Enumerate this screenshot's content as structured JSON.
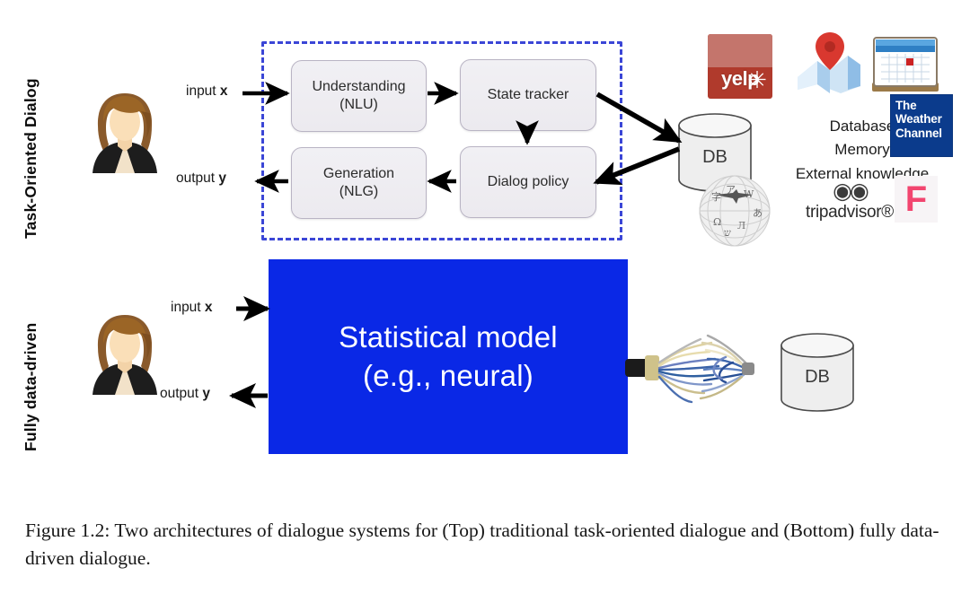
{
  "figure": {
    "caption": "Figure 1.2: Two architectures of dialogue systems for (Top) traditional task-oriented dialogue and (Bottom) fully data-driven dialogue."
  },
  "colors": {
    "dashed_border": "#3b46d6",
    "statistical_model_box": "#0a28e6",
    "module_box_fill": "#eceaef",
    "yelp_red": "#b03a2c",
    "weather_blue": "#0b3b8c",
    "foursquare_pink": "#f2456f"
  },
  "top_row": {
    "row_label": "Task-Oriented Dialog",
    "user_icon": "person-avatar-icon",
    "input_label_prefix": "input ",
    "input_label_var": "x",
    "output_label_prefix": "output ",
    "output_label_var": "y",
    "modules": [
      {
        "id": "nlu",
        "line1": "Understanding",
        "line2": "(NLU)"
      },
      {
        "id": "state-tracker",
        "line1": "State tracker",
        "line2": ""
      },
      {
        "id": "dialog-policy",
        "line1": "Dialog policy",
        "line2": ""
      },
      {
        "id": "nlg",
        "line1": "Generation",
        "line2": "(NLG)"
      }
    ],
    "db": {
      "label": "DB"
    },
    "knowledge_sources": {
      "line1": "Database",
      "line2": "Memory",
      "line3": "External knowledge"
    },
    "logos": [
      {
        "id": "yelp",
        "name": "yelp-logo",
        "text": "yelp",
        "mark": "✳"
      },
      {
        "id": "maps",
        "name": "google-maps-logo",
        "text": ""
      },
      {
        "id": "calendar",
        "name": "calendar-logo",
        "text": ""
      },
      {
        "id": "weather-channel",
        "name": "weather-channel-logo",
        "l1": "The",
        "l2": "Weather",
        "l3": "Channel"
      },
      {
        "id": "wikipedia",
        "name": "wikipedia-globe-logo",
        "text": ""
      },
      {
        "id": "tripadvisor",
        "name": "tripadvisor-logo",
        "owl": "◉◉",
        "text": "tripadvisor®"
      },
      {
        "id": "foursquare",
        "name": "foursquare-logo",
        "glyph": "F"
      }
    ]
  },
  "bottom_row": {
    "row_label": "Fully data-driven",
    "user_icon": "person-avatar-icon",
    "input_label_prefix": "input ",
    "input_label_var": "x",
    "output_label_prefix": "output ",
    "output_label_var": "y",
    "model_box": {
      "line1": "Statistical model",
      "line2": "(e.g., neural)"
    },
    "connector": "frayed-cable-icon",
    "db": {
      "label": "DB"
    }
  }
}
